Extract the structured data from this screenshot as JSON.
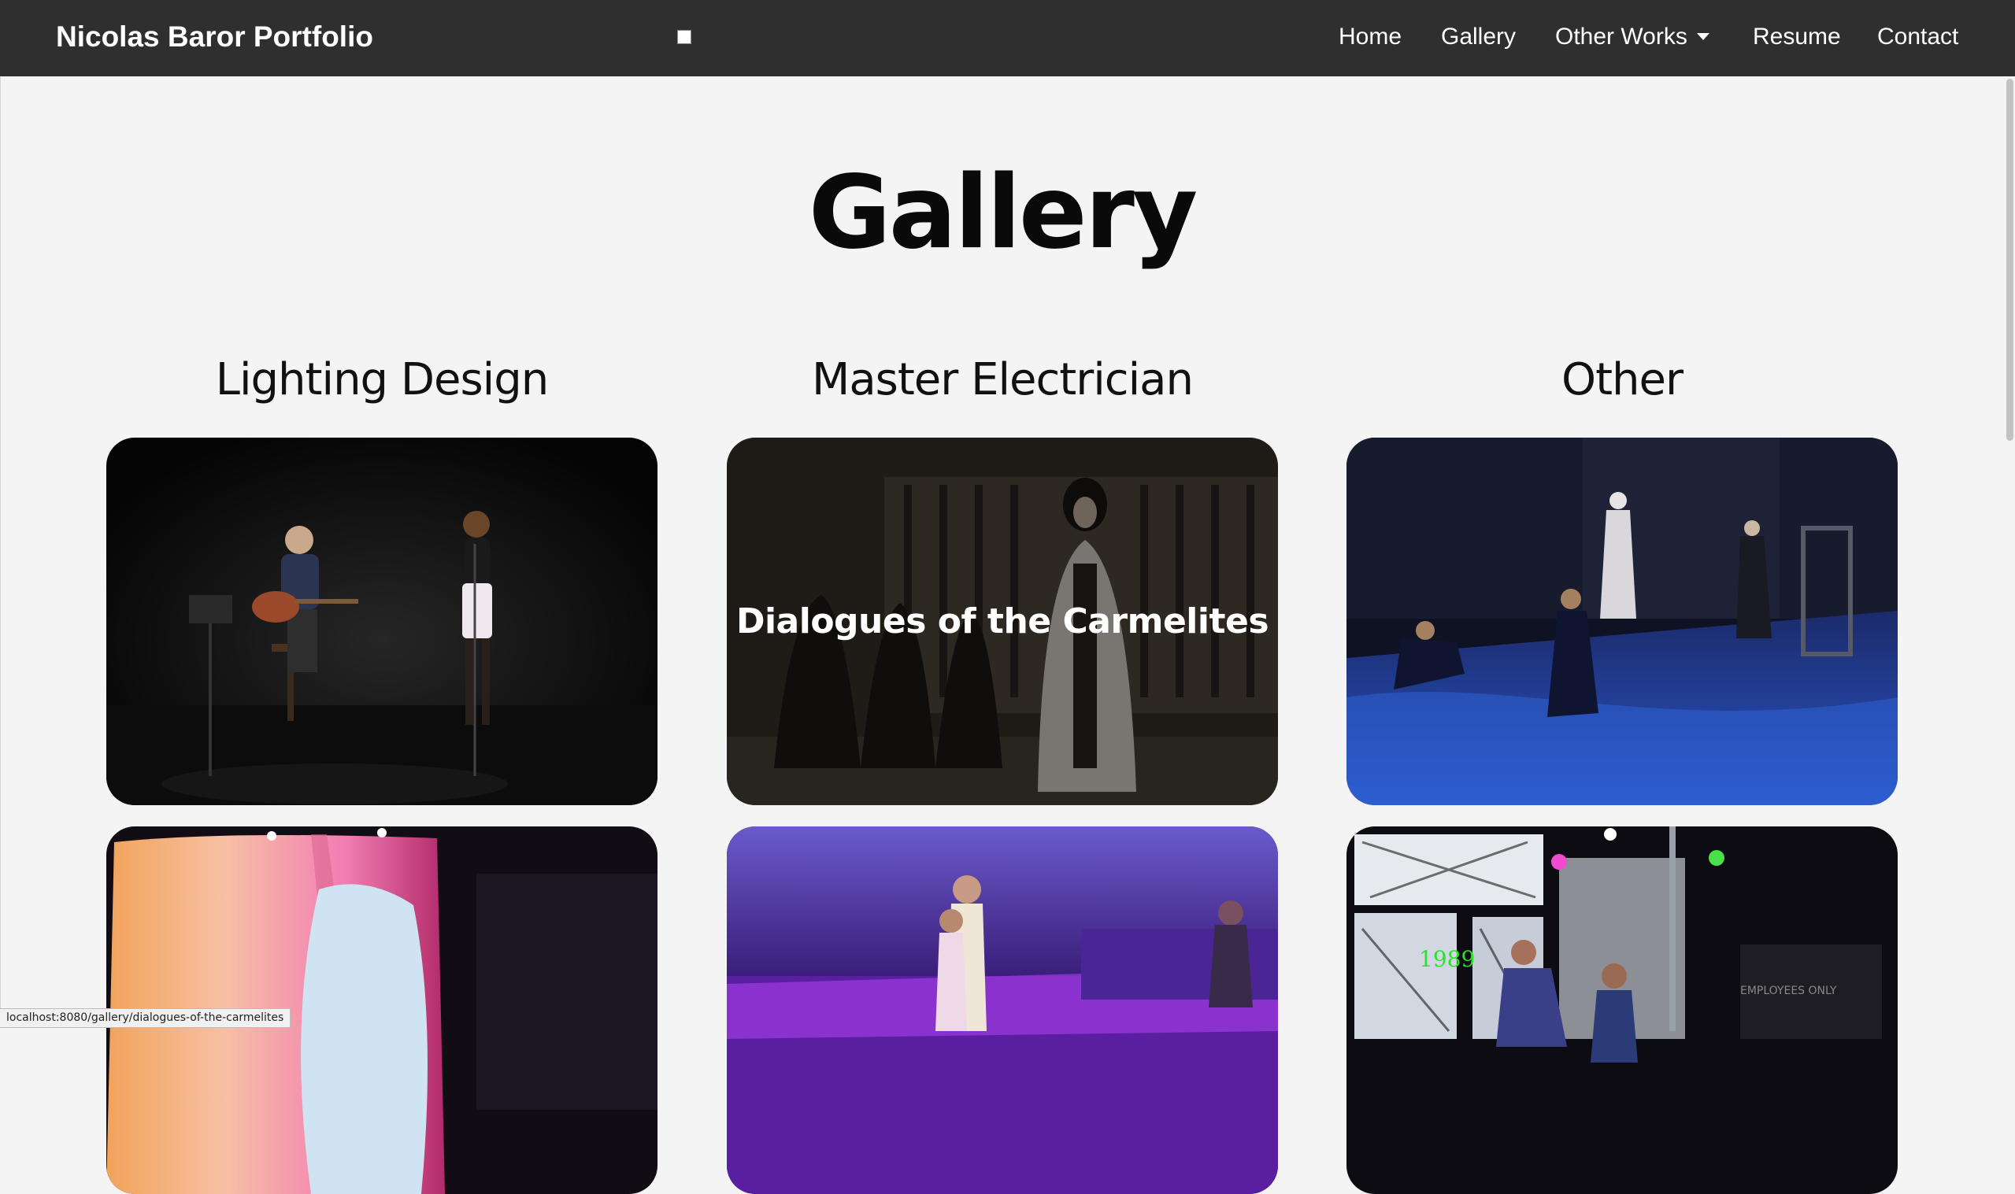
{
  "navbar": {
    "brand": "Nicolas Baror Portfolio",
    "links": {
      "home": "Home",
      "gallery": "Gallery",
      "other_works": "Other Works",
      "resume": "Resume",
      "contact": "Contact"
    }
  },
  "page": {
    "title": "Gallery"
  },
  "columns": {
    "lighting": {
      "heading": "Lighting Design"
    },
    "electrician": {
      "heading": "Master Electrician",
      "hover_label": "Dialogues of the Carmelites"
    },
    "other": {
      "heading": "Other"
    }
  },
  "status_bar": {
    "url": "localhost:8080/gallery/dialogues-of-the-carmelites"
  },
  "photo_text": {
    "year_sign": "1989",
    "employees_sign": "EMPLOYEES ONLY"
  },
  "colors": {
    "navbar_bg": "#2f2f2f",
    "page_bg": "#f4f4f4",
    "title_text": "#0a0a0a"
  }
}
